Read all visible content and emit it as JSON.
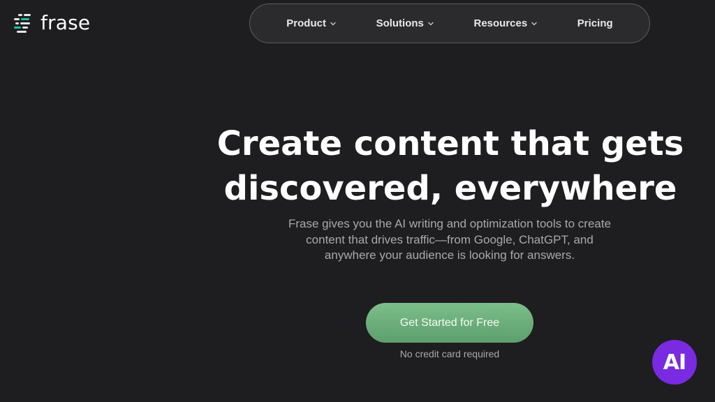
{
  "brand": {
    "name": "frase",
    "logo_icon": "frase-logo-icon",
    "logo_colors": [
      "#19c2a4",
      "#f2f2f2",
      "#ffffff"
    ]
  },
  "nav": {
    "items": [
      {
        "label": "Product",
        "has_dropdown": true
      },
      {
        "label": "Solutions",
        "has_dropdown": true
      },
      {
        "label": "Resources",
        "has_dropdown": true
      },
      {
        "label": "Pricing",
        "has_dropdown": false
      }
    ]
  },
  "hero": {
    "title_line1": "Create content that gets",
    "title_line2": "discovered, everywhere",
    "subtitle_line1": "Frase gives you the AI writing and optimization tools to create",
    "subtitle_line2": "content that drives traffic—from Google, ChatGPT, and",
    "subtitle_line3": "anywhere your audience is looking for answers.",
    "cta_label": "Get Started for Free",
    "cta_note": "No credit card required"
  },
  "ai_badge": {
    "label": "AI",
    "color": "#7a2ae0"
  },
  "colors": {
    "background": "#1e1d1f",
    "accent": "#6cae7b"
  }
}
